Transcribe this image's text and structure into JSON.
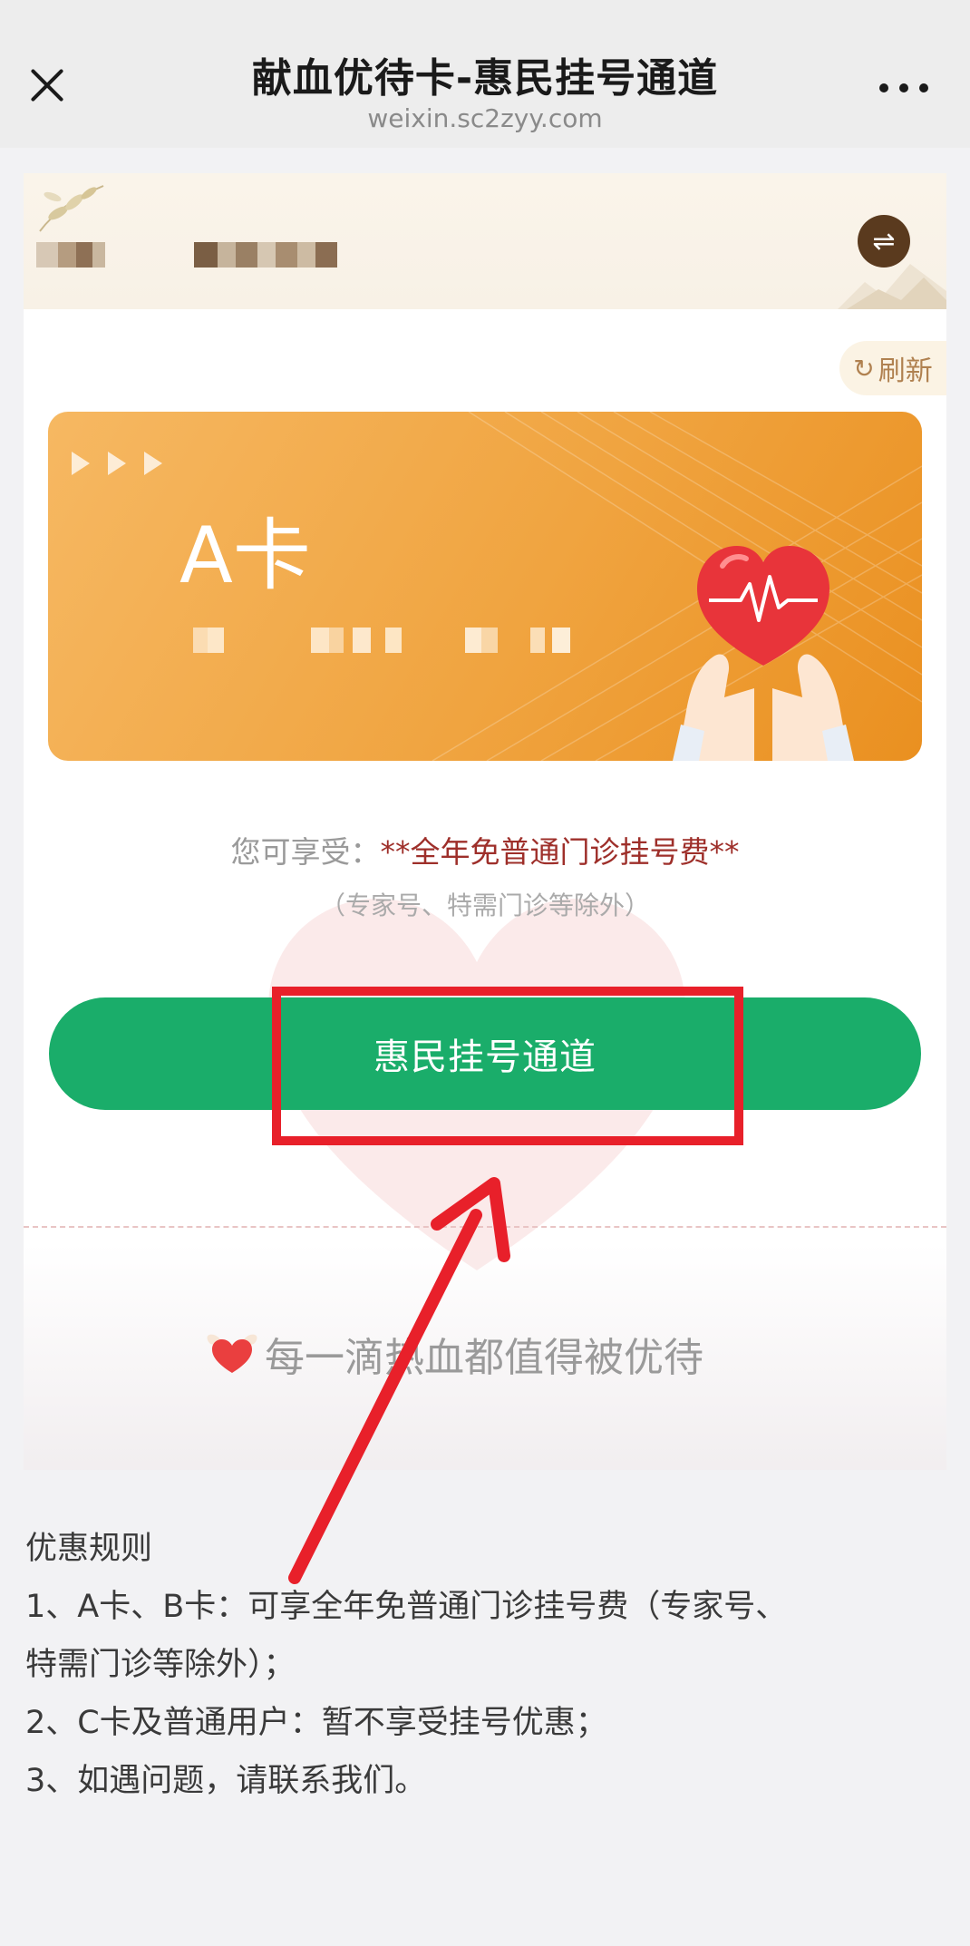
{
  "nav": {
    "title": "献血优待卡-惠民挂号通道",
    "url": "weixin.sc2zyy.com"
  },
  "card": {
    "refresh_label": "刷新",
    "swap_icon": "⇌",
    "a_card_title": "A卡",
    "benefit_prefix": "您可享受：",
    "benefit_highlight": "**全年免普通门诊挂号费**",
    "benefit_note": "（专家号、特需门诊等除外）",
    "button_label": "惠民挂号通道",
    "slogan": "每一滴热血都值得被优待"
  },
  "rules": {
    "title": "优惠规则",
    "items": [
      "1、A卡、B卡：可享全年免普通门诊挂号费（专家号、",
      "特需门诊等除外）；",
      "2、C卡及普通用户：暂不享受挂号优惠；",
      "3、如遇问题，请联系我们。"
    ]
  },
  "colors": {
    "accent_green": "#1aad6a",
    "card_orange": "#f0a440",
    "highlight_red": "#9e2f2a",
    "annotation_red": "#e8202a"
  }
}
